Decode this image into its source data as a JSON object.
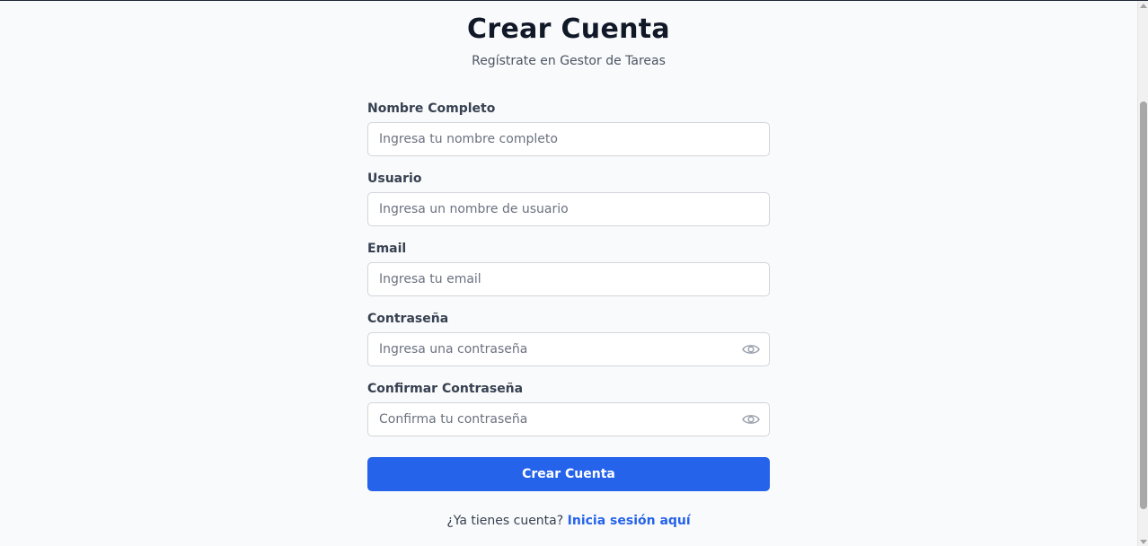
{
  "header": {
    "title": "Crear Cuenta",
    "subtitle": "Regístrate en Gestor de Tareas"
  },
  "form": {
    "fields": [
      {
        "label": "Nombre Completo",
        "placeholder": "Ingresa tu nombre completo",
        "value": ""
      },
      {
        "label": "Usuario",
        "placeholder": "Ingresa un nombre de usuario",
        "value": ""
      },
      {
        "label": "Email",
        "placeholder": "Ingresa tu email",
        "value": ""
      },
      {
        "label": "Contraseña",
        "placeholder": "Ingresa una contraseña",
        "value": "",
        "toggle_icon": "eye-icon"
      },
      {
        "label": "Confirmar Contraseña",
        "placeholder": "Confirma tu contraseña",
        "value": "",
        "toggle_icon": "eye-icon"
      }
    ],
    "submit_label": "Crear Cuenta"
  },
  "footer": {
    "prompt": "¿Ya tienes cuenta?",
    "link_label": "Inicia sesión aquí"
  },
  "colors": {
    "primary": "#2563eb",
    "background": "#f9fafb",
    "text": "#111827",
    "muted": "#4b5563",
    "border": "#d1d5db"
  }
}
